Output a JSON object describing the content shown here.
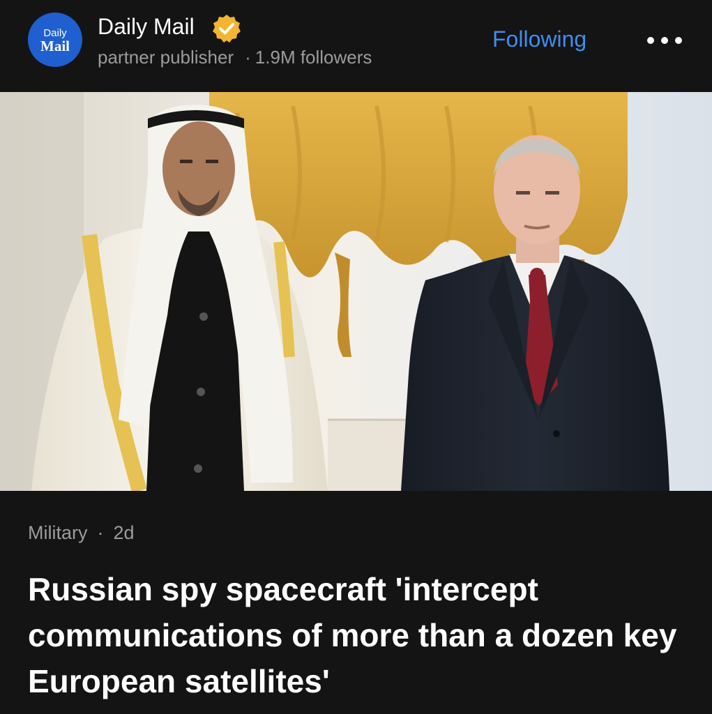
{
  "publisher": {
    "logo_line1": "Daily",
    "logo_line2": "Mail",
    "name": "Daily Mail",
    "verified_icon": "verified-badge-icon",
    "role": "partner publisher",
    "meta_separator": "·",
    "followers": "1.9M followers",
    "follow_label": "Following",
    "more_icon": "more-horizontal-icon"
  },
  "colors": {
    "background": "#141414",
    "accent_link": "#3f8ef0",
    "logo_background": "#1f5fcf",
    "verified_badge": "#f2b531",
    "muted_text": "#9c9c9c"
  },
  "article": {
    "category": "Military",
    "separator": "·",
    "age": "2d",
    "headline": "Russian spy spacecraft 'intercept communications of more than a dozen key European satellites'"
  }
}
